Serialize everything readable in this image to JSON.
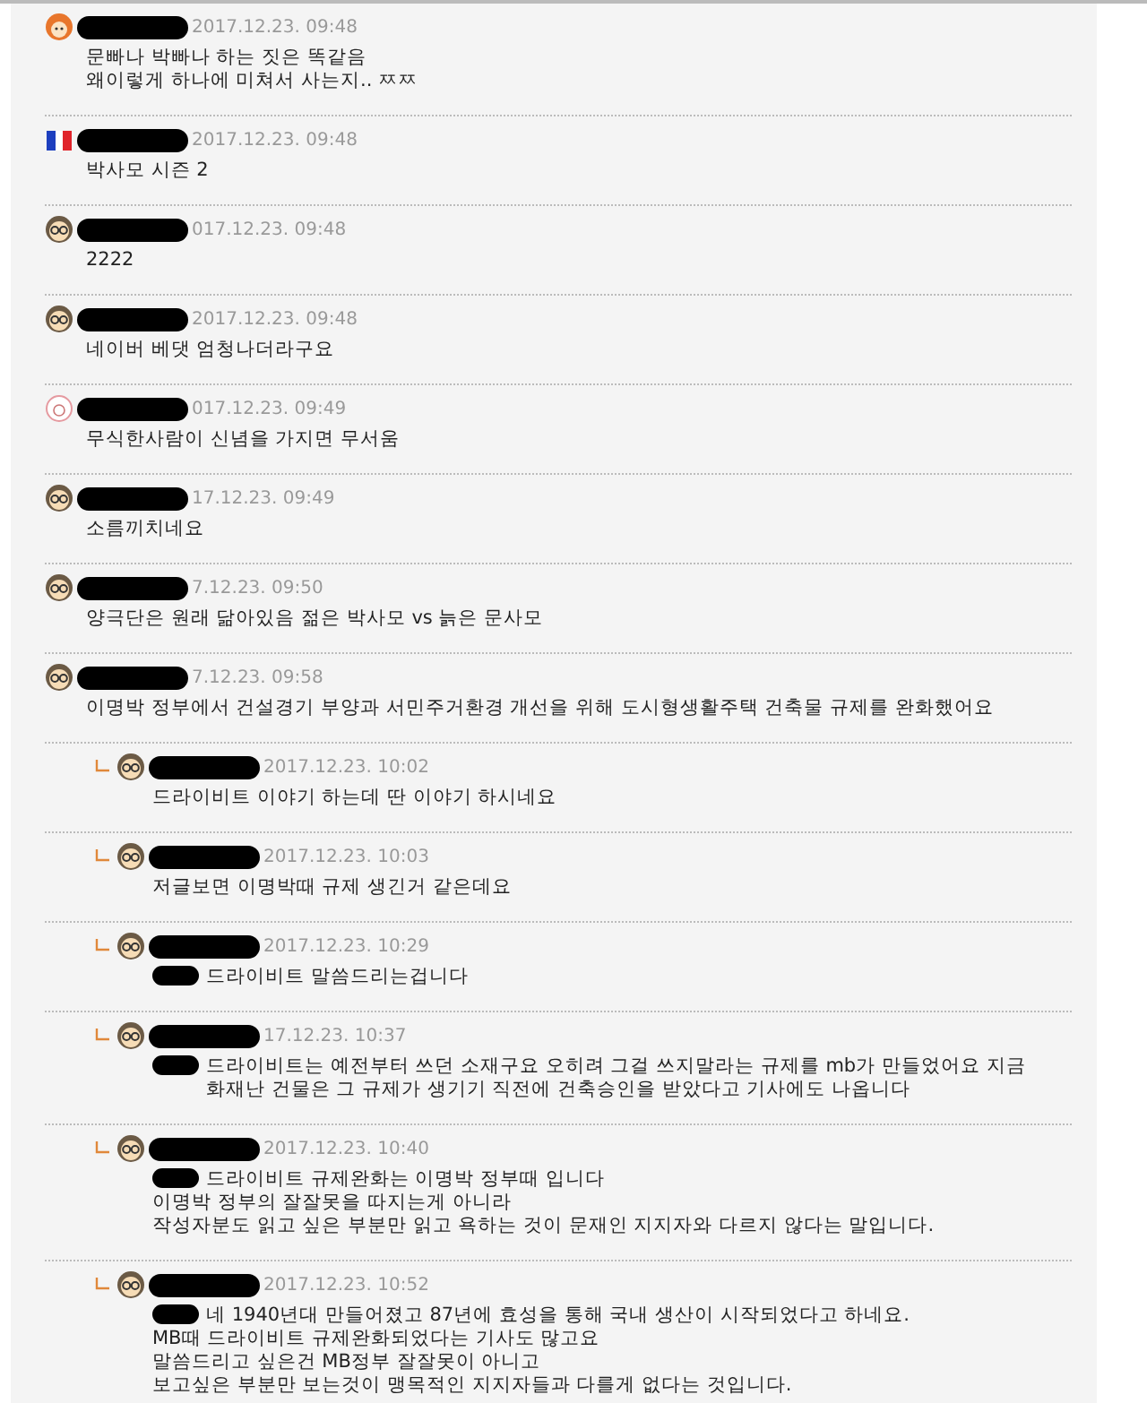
{
  "comments": [
    {
      "kind": "orange-face",
      "time": "2017.12.23. 09:48",
      "lines": [
        "문빠나 박빠나 하는 짓은 똑같음",
        "왜이렇게 하나에 미쳐서 사는지.. ㅉㅉ"
      ]
    },
    {
      "kind": "flag",
      "time": "2017.12.23. 09:48",
      "lines": [
        "박사모 시즌 2"
      ]
    },
    {
      "kind": "glasses-face",
      "time": "017.12.23. 09:48",
      "lines": [
        "2222"
      ]
    },
    {
      "kind": "glasses-face",
      "time": "2017.12.23. 09:48",
      "lines": [
        "네이버 베댓 엄청나더라구요"
      ]
    },
    {
      "kind": "sticker-face",
      "time": "017.12.23. 09:49",
      "lines": [
        "무식한사람이 신념을 가지면 무서움"
      ]
    },
    {
      "kind": "glasses-face",
      "time": "17.12.23. 09:49",
      "lines": [
        "소름끼치네요"
      ]
    },
    {
      "kind": "glasses-face",
      "time": "7.12.23. 09:50",
      "lines": [
        "양극단은 원래 닮아있음 젊은 박사모 vs 늙은 문사모"
      ]
    },
    {
      "kind": "glasses-face",
      "time": "7.12.23. 09:58",
      "lines": [
        "이명박 정부에서 건설경기 부양과 서민주거환경 개선을 위해 도시형생활주택 건축물 규제를 완화했어요"
      ],
      "children": [
        {
          "kind": "glasses-face",
          "time": "2017.12.23. 10:02",
          "body_redacted": false,
          "lines": [
            "드라이비트 이야기 하는데 딴 이야기 하시네요"
          ]
        },
        {
          "kind": "glasses-face",
          "time": "2017.12.23. 10:03",
          "body_redacted": false,
          "lines": [
            "저글보면 이명박때 규제 생긴거 같은데요"
          ]
        },
        {
          "kind": "glasses-face",
          "time": "2017.12.23. 10:29",
          "body_redacted": true,
          "lines": [
            "드라이비트 말씀드리는겁니다"
          ]
        },
        {
          "kind": "glasses-face",
          "time": "17.12.23. 10:37",
          "body_redacted": true,
          "lines": [
            "드라이비트는 예전부터 쓰던 소재구요 오히려 그걸 쓰지말라는 규제를 mb가 만들었어요 지금 화재난 건물은 그 규제가 생기기 직전에 건축승인을 받았다고 기사에도 나옵니다"
          ]
        },
        {
          "kind": "glasses-face",
          "time": "2017.12.23. 10:40",
          "body_redacted": true,
          "lines": [
            "드라이비트 규제완화는 이명박 정부때 입니다",
            "이명박 정부의 잘잘못을 따지는게 아니라",
            "작성자분도 읽고 싶은 부분만 읽고 욕하는 것이 문재인 지지자와 다르지 않다는 말입니다."
          ]
        },
        {
          "kind": "glasses-face",
          "time": "2017.12.23. 10:52",
          "body_redacted": true,
          "lines": [
            "네 1940년대 만들어졌고 87년에 효성을 통해 국내 생산이 시작되었다고 하네요.",
            "MB때 드라이비트 규제완화되었다는 기사도 많고요",
            "말씀드리고 싶은건 MB정부 잘잘못이 아니고",
            "보고싶은 부분만 보는것이 맹목적인 지지자들과 다를게 없다는 것입니다."
          ]
        }
      ]
    }
  ]
}
